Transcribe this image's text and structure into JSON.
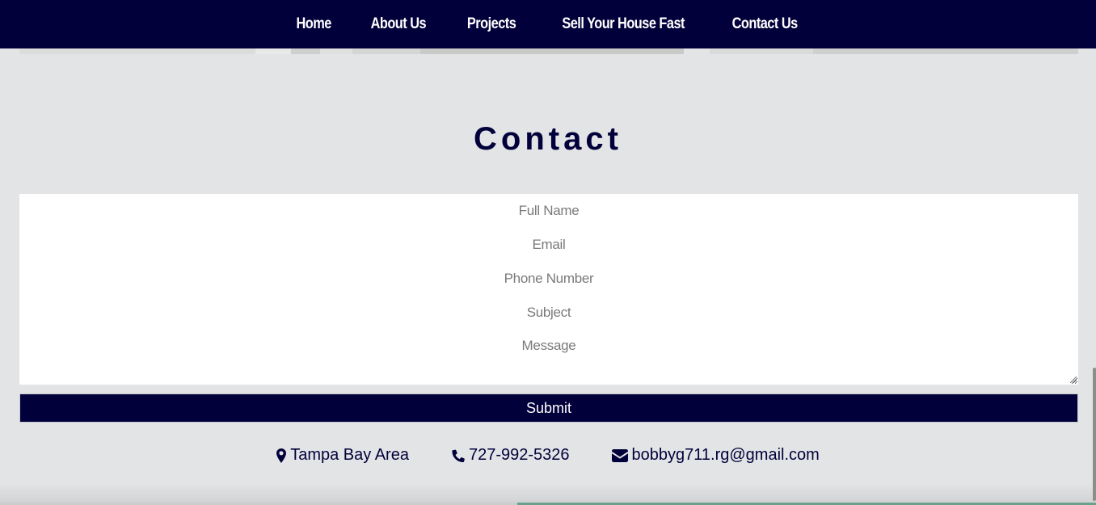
{
  "nav": {
    "items": [
      {
        "label": "Home"
      },
      {
        "label": "About Us"
      },
      {
        "label": "Projects"
      },
      {
        "label": "Sell Your House Fast"
      },
      {
        "label": "Contact Us"
      }
    ]
  },
  "contact": {
    "title": "Contact",
    "form": {
      "full_name_placeholder": "Full Name",
      "email_placeholder": "Email",
      "phone_placeholder": "Phone Number",
      "subject_placeholder": "Subject",
      "message_placeholder": "Message",
      "submit_label": "Submit"
    },
    "info": {
      "location": "Tampa Bay Area",
      "phone": "727-992-5326",
      "email": "bobbyg711.rg@gmail.com"
    }
  },
  "colors": {
    "brand_navy": "#02003a",
    "page_background": "#e3e4e6",
    "form_background": "#ffffff"
  },
  "icons": {
    "location": "map-marker-icon",
    "phone": "phone-icon",
    "email": "envelope-icon"
  }
}
